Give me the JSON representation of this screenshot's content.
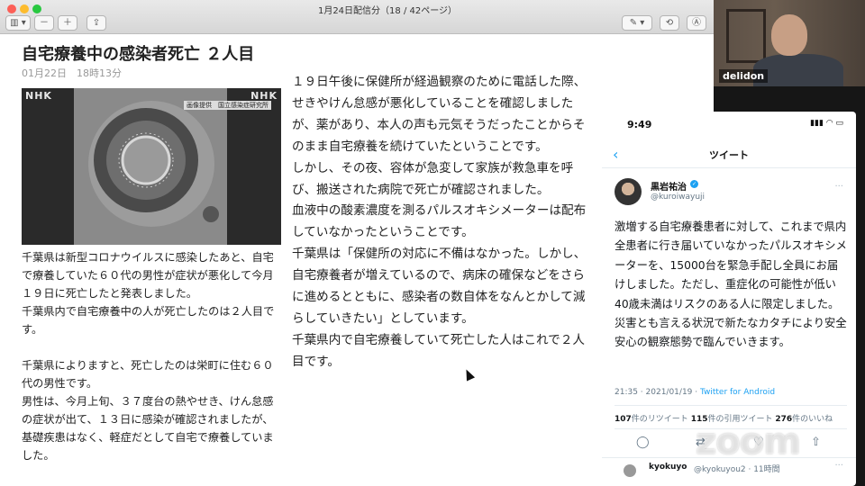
{
  "window": {
    "title": "1月24日配信分（18 / 42ページ）",
    "toolbar": {
      "sidebar_icon": "▥ ▾",
      "zoom_out_icon": "－",
      "zoom_in_icon": "＋",
      "share_icon": "⇪",
      "markup_icon": "✎ ▾",
      "rotate_icon": "⟲",
      "annotate_icon": "Ⓐ"
    }
  },
  "article": {
    "title": "自宅療養中の感染者死亡 ２人目",
    "date": "01月22日　18時13分",
    "photo": {
      "logo_left": "NHK",
      "logo_right": "NHK",
      "caption": "画像提供　国立感染症研究所"
    },
    "left_paragraphs": [
      "千葉県は新型コロナウイルスに感染したあと、自宅で療養していた６０代の男性が症状が悪化して今月１９日に死亡したと発表しました。",
      "千葉県内で自宅療養中の人が死亡したのは２人目です。",
      "",
      "千葉県によりますと、死亡したのは栄町に住む６０代の男性です。",
      "男性は、今月上旬、３７度台の熱やせき、けん怠感の症状が出て、１３日に感染が確認されましたが、基礎疾患はなく、軽症だとして自宅で療養していました。"
    ],
    "middle_paragraphs": [
      "１９日午後に保健所が経過観察のために電話した際、せきやけん怠感が悪化していることを確認しましたが、薬があり、本人の声も元気そうだったことからそのまま自宅療養を続けていたということです。",
      "しかし、その夜、容体が急変して家族が救急車を呼び、搬送された病院で死亡が確認されました。",
      "血液中の酸素濃度を測るパルスオキシメーターは配布していなかったということです。",
      "千葉県は「保健所の対応に不備はなかった。しかし、自宅療養者が増えているので、病床の確保などをさらに進めるとともに、感染者の数自体をなんとかして減らしていきたい」としています。",
      "千葉県内で自宅療養していて死亡した人はこれで２人目です。"
    ]
  },
  "phone": {
    "time": "9:49",
    "status_icons": "▮▮▮ ◠ ▭",
    "back_icon": "‹",
    "nav_title": "ツイート",
    "author_name": "黒岩祐治",
    "verified_icon": "✓",
    "author_handle": "@kuroiwayuji",
    "more_icon": "···",
    "tweet_text": "激増する自宅療養患者に対して、これまで県内全患者に行き届いていなかったパルスオキシメーターを、15000台を緊急手配し全員にお届けしました。ただし、重症化の可能性が低い40歳未満はリスクのある人に限定しました。災害とも言える状況で新たなカタチにより安全安心の観察態勢で臨んでいきます。",
    "meta_time": "21:35 · 2021/01/19 · ",
    "meta_source": "Twitter for Android",
    "retweets_count": "107",
    "retweets_label": "件のリツイート",
    "quotes_count": "115",
    "quotes_label": "件の引用ツイート",
    "likes_count": "276",
    "likes_label": "件のいいね",
    "reply_icon": "◯",
    "retweet_icon": "⇄",
    "like_icon": "♡",
    "share_icon": "⇧",
    "reply_user": "kyokuyo",
    "reply_meta": "@kyokuyou2 · 11時間",
    "reply_more": "···"
  },
  "webcam": {
    "name": "delidon"
  },
  "watermark": "zoom"
}
